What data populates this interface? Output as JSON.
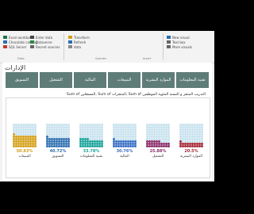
{
  "ribbon": {
    "groups": [
      {
        "items": [
          "Excel workbook",
          "Chocolate catalog",
          "SQL Server"
        ],
        "icon_colors": [
          "#1e7145",
          "#2b6cb0",
          "#c0392b"
        ]
      },
      {
        "items": [
          "Enter data",
          "Dataverse",
          "Recent sources"
        ],
        "icon_colors": [
          "#444444",
          "#2b8a3e",
          "#666666"
        ]
      },
      {
        "items": [
          "Transform",
          "Refresh",
          "data"
        ],
        "icon_colors": [
          "#d4a017",
          "#2b6cb0",
          "#888888"
        ]
      },
      {
        "items": [
          "New visual",
          "Text box",
          "More visuals"
        ],
        "icon_colors": [
          "#2b6cb0",
          "#666666",
          "#666666"
        ]
      }
    ],
    "group_names": [
      "Data",
      "Queries",
      "Insert"
    ]
  },
  "header": {
    "title": "الإدارات"
  },
  "nav": [
    "تقنية المعلومات",
    "الموارد البشرية",
    "المبيعات",
    "المالية",
    "التشغيل",
    "التسويق"
  ],
  "panel_title": "Sum of المسجلين, Sum of المنجزات, Sum of التدريب المنجز و النسبة المئوية الموظفين",
  "kpis": [
    {
      "pct": "50.83%",
      "label": "المبيعات",
      "color": "#d4a017",
      "fill": 0.5083
    },
    {
      "pct": "40.72%",
      "label": "التسويق",
      "color": "#2f6fb0",
      "fill": 0.4072
    },
    {
      "pct": "33.78%",
      "label": "تقنية المعلومات",
      "color": "#1aa39a",
      "fill": 0.3378
    },
    {
      "pct": "30.76%",
      "label": "المالية",
      "color": "#3a6fc4",
      "fill": 0.3076
    },
    {
      "pct": "25.88%",
      "label": "التشغيل",
      "color": "#8b2d6b",
      "fill": 0.2588
    },
    {
      "pct": "20.5%",
      "label": "الموارد البشرية",
      "color": "#a52a3a",
      "fill": 0.205
    }
  ],
  "bg_dot_color": "#c7e2ee"
}
